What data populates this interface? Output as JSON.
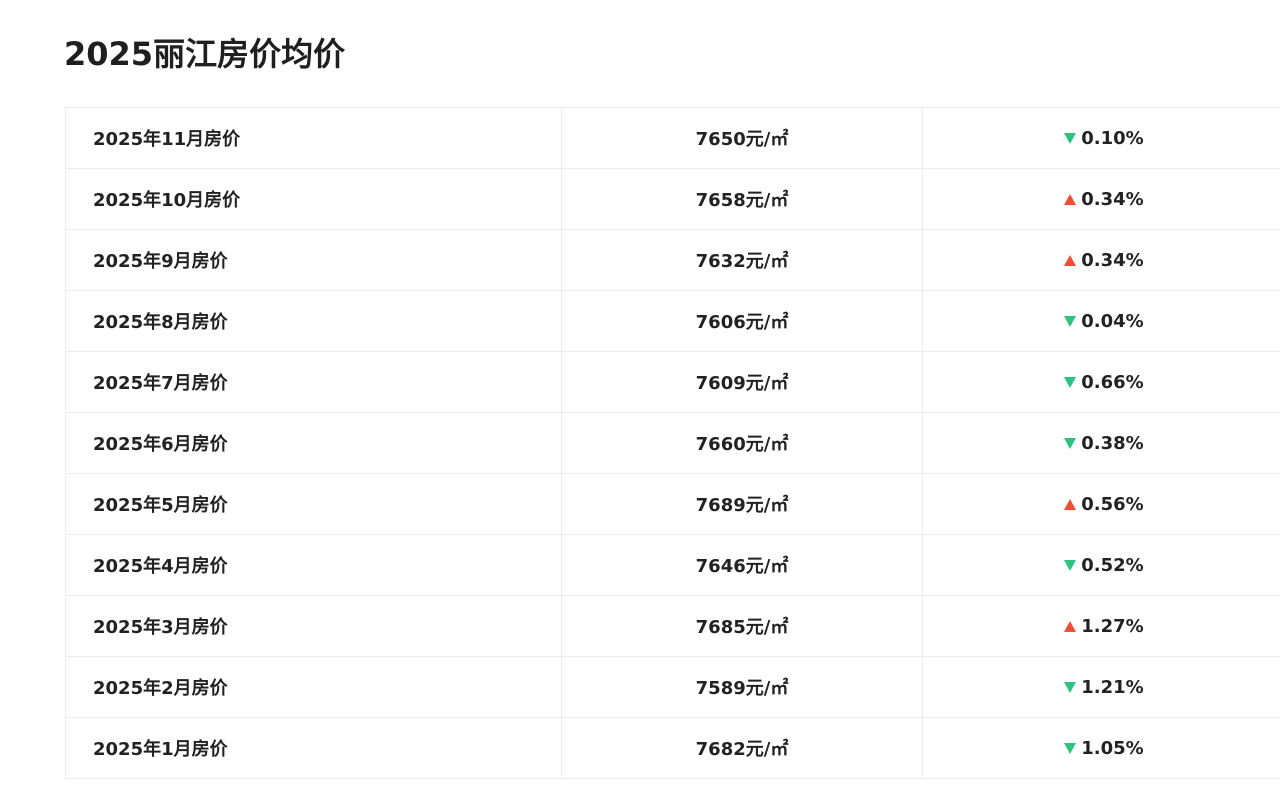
{
  "page": {
    "title": "2025丽江房价均价"
  },
  "colors": {
    "up": "#f04e32",
    "down": "#2dc37e",
    "border": "#ececec"
  },
  "rows": [
    {
      "month": "2025年11月房价",
      "price": "7650元/㎡",
      "direction": "down",
      "change": "0.10%"
    },
    {
      "month": "2025年10月房价",
      "price": "7658元/㎡",
      "direction": "up",
      "change": "0.34%"
    },
    {
      "month": "2025年9月房价",
      "price": "7632元/㎡",
      "direction": "up",
      "change": "0.34%"
    },
    {
      "month": "2025年8月房价",
      "price": "7606元/㎡",
      "direction": "down",
      "change": "0.04%"
    },
    {
      "month": "2025年7月房价",
      "price": "7609元/㎡",
      "direction": "down",
      "change": "0.66%"
    },
    {
      "month": "2025年6月房价",
      "price": "7660元/㎡",
      "direction": "down",
      "change": "0.38%"
    },
    {
      "month": "2025年5月房价",
      "price": "7689元/㎡",
      "direction": "up",
      "change": "0.56%"
    },
    {
      "month": "2025年4月房价",
      "price": "7646元/㎡",
      "direction": "down",
      "change": "0.52%"
    },
    {
      "month": "2025年3月房价",
      "price": "7685元/㎡",
      "direction": "up",
      "change": "1.27%"
    },
    {
      "month": "2025年2月房价",
      "price": "7589元/㎡",
      "direction": "down",
      "change": "1.21%"
    },
    {
      "month": "2025年1月房价",
      "price": "7682元/㎡",
      "direction": "down",
      "change": "1.05%"
    }
  ]
}
